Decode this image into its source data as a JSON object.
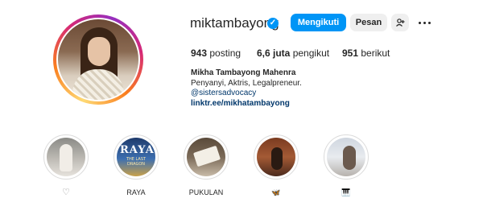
{
  "profile": {
    "username": "miktambayong",
    "verified_icon": "verified-badge-icon",
    "follow_label": "Mengikuti",
    "message_label": "Pesan",
    "add_user_icon": "+°",
    "more_icon": "more-options-icon"
  },
  "stats": {
    "posts_value": "943",
    "posts_label": "posting",
    "followers_value": "6,6 juta",
    "followers_label": "pengikut",
    "following_value": "951",
    "following_label": "berikut"
  },
  "bio": {
    "name": "Mikha Tambayong Mahenra",
    "description": "Penyanyi, Aktris, Legalpreneur.",
    "mention": "@sistersadvocacy",
    "link": "linktr.ee/mikhatambayong"
  },
  "highlights": [
    {
      "label": "♡",
      "icon": "heart-icon"
    },
    {
      "label": "RAYA",
      "cover_title": "RAYA",
      "cover_subtitle": "THE LAST DRAGON"
    },
    {
      "label": "PUKULAN"
    },
    {
      "label": "🦋",
      "icon": "butterfly-icon"
    },
    {
      "label": "🎹",
      "icon": "piano-icon"
    }
  ],
  "colors": {
    "follow_button": "#0095f6",
    "secondary_button": "#efefef",
    "link": "#00376b",
    "text": "#262626"
  }
}
